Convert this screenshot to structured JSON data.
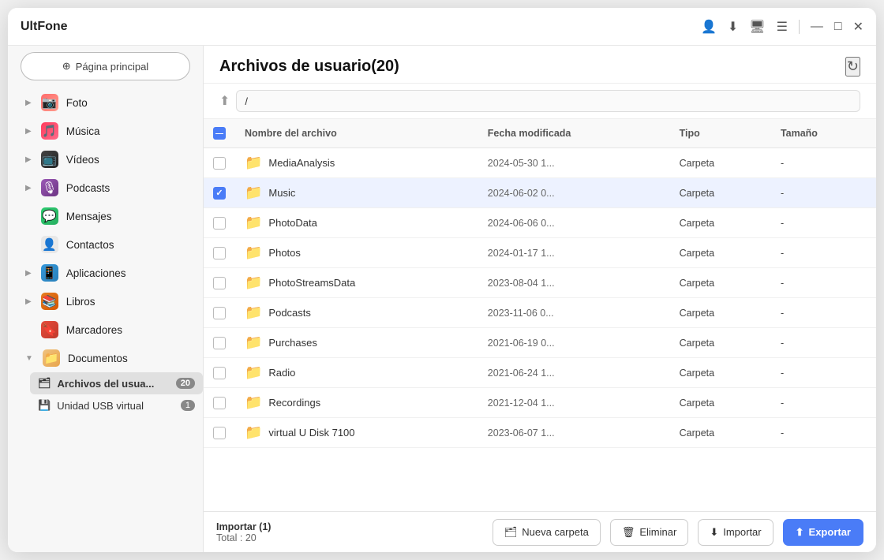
{
  "app": {
    "name": "UltFone"
  },
  "titlebar": {
    "profile_icon": "👤",
    "download_icon": "⬇",
    "screen_icon": "🖥",
    "menu_icon": "☰",
    "minimize_icon": "—",
    "maximize_icon": "□",
    "close_icon": "✕"
  },
  "sidebar": {
    "home_button": "Página principal",
    "items": [
      {
        "id": "foto",
        "label": "Foto",
        "icon": "📷",
        "has_expand": true,
        "icon_class": "icon-foto"
      },
      {
        "id": "musica",
        "label": "Música",
        "icon": "🎵",
        "has_expand": true,
        "icon_class": "icon-music"
      },
      {
        "id": "videos",
        "label": "Vídeos",
        "icon": "📺",
        "has_expand": true,
        "icon_class": "icon-video"
      },
      {
        "id": "podcasts",
        "label": "Podcasts",
        "icon": "🎙",
        "has_expand": true,
        "icon_class": "icon-podcast"
      },
      {
        "id": "mensajes",
        "label": "Mensajes",
        "icon": "💬",
        "has_expand": false,
        "icon_class": "icon-msg"
      },
      {
        "id": "contactos",
        "label": "Contactos",
        "icon": "👤",
        "has_expand": false,
        "icon_class": "icon-contact"
      },
      {
        "id": "aplicaciones",
        "label": "Aplicaciones",
        "icon": "📱",
        "has_expand": true,
        "icon_class": "icon-apps"
      },
      {
        "id": "libros",
        "label": "Libros",
        "icon": "📚",
        "has_expand": true,
        "icon_class": "icon-books"
      },
      {
        "id": "marcadores",
        "label": "Marcadores",
        "icon": "🔖",
        "has_expand": false,
        "icon_class": "icon-marks"
      }
    ],
    "documents": {
      "label": "Documentos",
      "icon": "📁",
      "expanded": true,
      "sub_items": [
        {
          "id": "archivos",
          "label": "Archivos del usua...",
          "badge": "20",
          "active": true
        },
        {
          "id": "usb",
          "label": "Unidad USB virtual",
          "badge": "1"
        }
      ]
    }
  },
  "content": {
    "title": "Archivos de usuario(20)",
    "path": "/",
    "columns": [
      "Nombre del archivo",
      "Fecha modificada",
      "Tipo",
      "Tamaño"
    ],
    "files": [
      {
        "name": "MediaAnalysis",
        "date": "2024-05-30 1...",
        "type": "Carpeta",
        "size": "-",
        "checked": false
      },
      {
        "name": "Music",
        "date": "2024-06-02 0...",
        "type": "Carpeta",
        "size": "-",
        "checked": true
      },
      {
        "name": "PhotoData",
        "date": "2024-06-06 0...",
        "type": "Carpeta",
        "size": "-",
        "checked": false
      },
      {
        "name": "Photos",
        "date": "2024-01-17 1...",
        "type": "Carpeta",
        "size": "-",
        "checked": false
      },
      {
        "name": "PhotoStreamsData",
        "date": "2023-08-04 1...",
        "type": "Carpeta",
        "size": "-",
        "checked": false
      },
      {
        "name": "Podcasts",
        "date": "2023-11-06 0...",
        "type": "Carpeta",
        "size": "-",
        "checked": false
      },
      {
        "name": "Purchases",
        "date": "2021-06-19 0...",
        "type": "Carpeta",
        "size": "-",
        "checked": false
      },
      {
        "name": "Radio",
        "date": "2021-06-24 1...",
        "type": "Carpeta",
        "size": "-",
        "checked": false
      },
      {
        "name": "Recordings",
        "date": "2021-12-04 1...",
        "type": "Carpeta",
        "size": "-",
        "checked": false
      },
      {
        "name": "virtual U Disk 7100",
        "date": "2023-06-07 1...",
        "type": "Carpeta",
        "size": "-",
        "checked": false
      }
    ]
  },
  "footer": {
    "import_label": "Importar (1)",
    "total_label": "Total : 20",
    "new_folder": "Nueva carpeta",
    "delete": "Eliminar",
    "import": "Importar",
    "export": "Exportar"
  }
}
